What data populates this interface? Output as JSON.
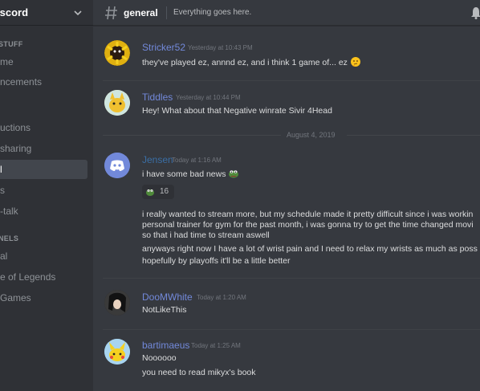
{
  "server": {
    "name": "Discord"
  },
  "sidebar": {
    "categories": [
      {
        "label": "STUFF",
        "items": [
          {
            "label": "Home"
          },
          {
            "label": "Announcements"
          }
        ]
      },
      {
        "label": "",
        "items": [
          {
            "label": "instructions"
          },
          {
            "label": "clip-sharing"
          },
          {
            "label": "general",
            "active": true
          },
          {
            "label": "memes"
          },
          {
            "label": "off-topic-talk"
          }
        ]
      },
      {
        "label": "CHANNELS",
        "items": [
          {
            "label": "General"
          },
          {
            "label": "League of Legends"
          },
          {
            "label": "Other Games"
          }
        ]
      }
    ]
  },
  "sidebar_visible": {
    "cat1": "STUFF",
    "item1": "me",
    "item2": "ncements",
    "item3": "uctions",
    "item4": "sharing",
    "item5": "l",
    "item6": "s",
    "item7": "-talk",
    "cat2": "NELS",
    "item8": "al",
    "item9": "e of Legends",
    "item10": "Games",
    "server_name": "iscord"
  },
  "header": {
    "channel": "general",
    "topic": "Everything goes here."
  },
  "date_divider": "August 4, 2019",
  "messages": [
    {
      "author": "Stricker52",
      "author_color": "#7289da",
      "timestamp": "Yesterday at 10:43 PM",
      "lines": [
        "they've played ez, annnd ez, and i think 1 game of... ez"
      ]
    },
    {
      "author": "Tiddles",
      "author_color": "#7289da",
      "timestamp": "Yesterday at 10:44 PM",
      "lines": [
        "Hey! What about that Negative winrate Sivir 4Head"
      ]
    },
    {
      "author": "Jensen",
      "author_color": "#3a6ea5",
      "timestamp": "Today at 1:16 AM",
      "lines": [
        "i have some bad news",
        "i really wanted to stream more, but my schedule made it pretty difficult since i was workin",
        "personal trainer for gym for the past month, i was gonna try to get the time changed movi",
        "so that i had time to stream aswell",
        "anyways right now I have a lot of wrist pain and I need to relax my wrists as much as poss",
        "hopefully by playoffs it'll be a little better"
      ],
      "reaction_count": "16"
    },
    {
      "author": "DooMWhite",
      "author_color": "#7289da",
      "timestamp": "Today at 1:20 AM",
      "lines": [
        "NotLikeThis"
      ]
    },
    {
      "author": "bartimaeus",
      "author_color": "#7289da",
      "timestamp": "Today at 1:25 AM",
      "lines": [
        "Noooooo",
        "you need to read mikyx's book"
      ]
    }
  ],
  "icons": {
    "chevron": "chevron-down-icon",
    "hash": "hash-icon",
    "bell": "bell-icon"
  }
}
